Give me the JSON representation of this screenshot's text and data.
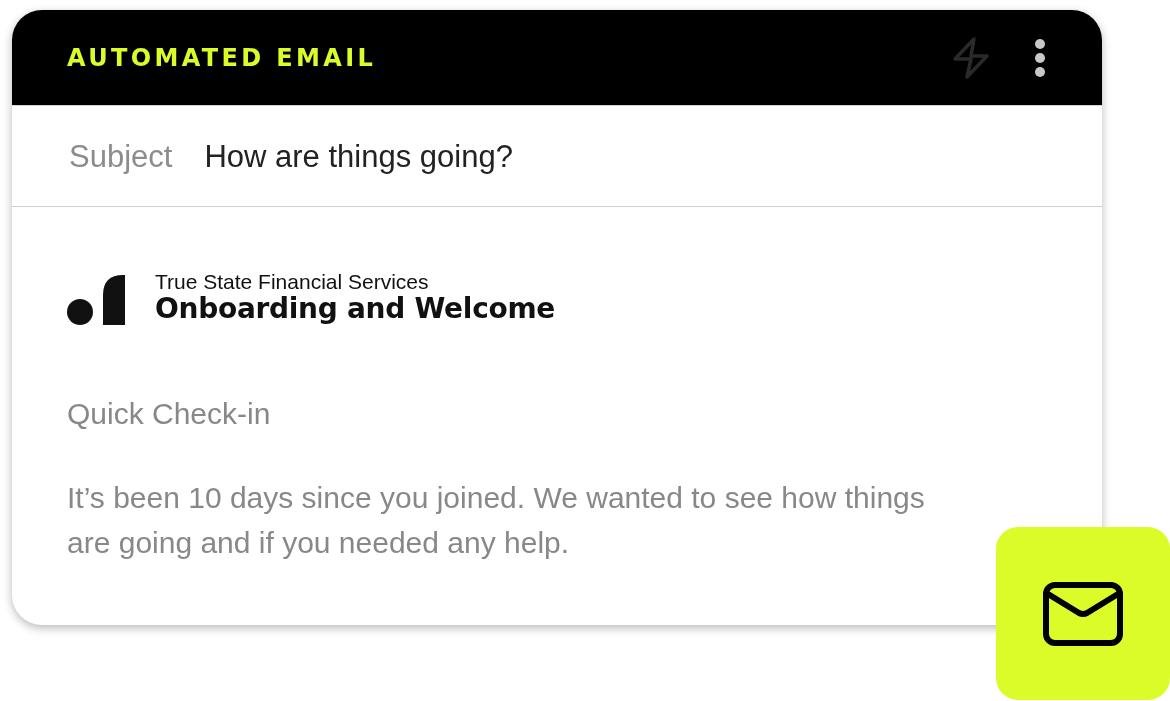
{
  "card": {
    "title": "AUTOMATED EMAIL",
    "subject": {
      "label": "Subject",
      "value": "How are things going?"
    },
    "sender": {
      "organization": "True State Financial Services",
      "campaign": "Onboarding and Welcome"
    },
    "heading": "Quick Check-in",
    "body": "It’s been 10 days since you joined. We wanted to see how things are going and if you needed any help."
  }
}
